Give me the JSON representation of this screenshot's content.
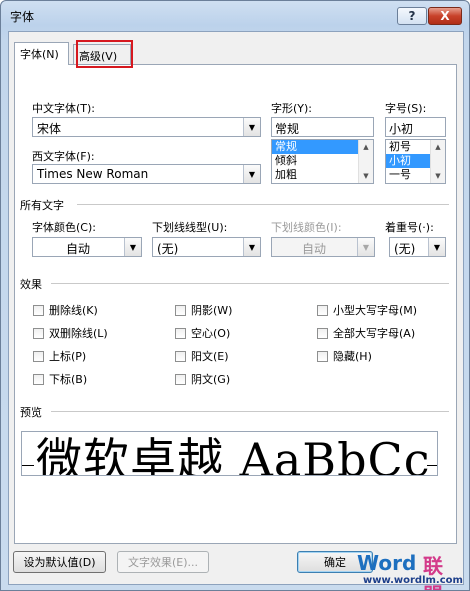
{
  "window": {
    "title": "字体",
    "help_label": "?",
    "close_label": "X"
  },
  "tabs": [
    {
      "label": "字体(N)",
      "active": true
    },
    {
      "label": "高级(V)",
      "active": false,
      "highlighted": true
    }
  ],
  "font": {
    "cn_font_label": "中文字体(T):",
    "cn_font_value": "宋体",
    "west_font_label": "西文字体(F):",
    "west_font_value": "Times New Roman",
    "style_label": "字形(Y):",
    "style_value": "常规",
    "style_options": [
      "常规",
      "倾斜",
      "加粗"
    ],
    "style_selected": "常规",
    "size_label": "字号(S):",
    "size_value": "小初",
    "size_options": [
      "初号",
      "小初",
      "一号"
    ],
    "size_selected": "小初"
  },
  "all_text": {
    "header": "所有文字",
    "color_label": "字体颜色(C):",
    "color_value": "自动",
    "underline_style_label": "下划线线型(U):",
    "underline_style_value": "(无)",
    "underline_color_label": "下划线颜色(I):",
    "underline_color_value": "自动",
    "emphasis_label": "着重号(·):",
    "emphasis_value": "(无)"
  },
  "effects": {
    "header": "效果",
    "col1": [
      {
        "label": "删除线(K)",
        "checked": false
      },
      {
        "label": "双删除线(L)",
        "checked": false
      },
      {
        "label": "上标(P)",
        "checked": false
      },
      {
        "label": "下标(B)",
        "checked": false
      }
    ],
    "col2": [
      {
        "label": "阴影(W)",
        "checked": false
      },
      {
        "label": "空心(O)",
        "checked": false
      },
      {
        "label": "阳文(E)",
        "checked": false
      },
      {
        "label": "阴文(G)",
        "checked": false
      }
    ],
    "col3": [
      {
        "label": "小型大写字母(M)",
        "checked": false
      },
      {
        "label": "全部大写字母(A)",
        "checked": false
      },
      {
        "label": "隐藏(H)",
        "checked": false
      }
    ]
  },
  "preview": {
    "header": "预览",
    "sample": "微软卓越 AaBbCc"
  },
  "buttons": {
    "set_default": "设为默认值(D)",
    "text_effects": "文字效果(E)...",
    "ok": "确定"
  },
  "watermark": {
    "brand_word": "Word",
    "brand_cn": "联盟",
    "url": "www.wordlm.com"
  },
  "colors": {
    "selection": "#3399ff",
    "highlight_box": "#d6181f"
  }
}
